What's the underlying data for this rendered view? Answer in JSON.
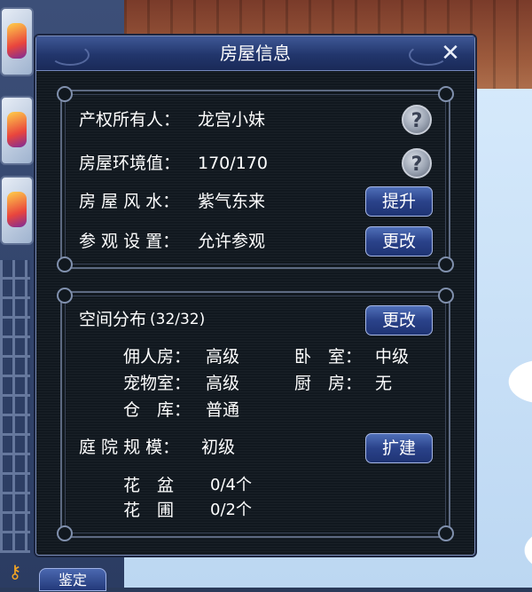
{
  "dialog": {
    "title": "房屋信息",
    "close_icon": "close-icon"
  },
  "house_panel": {
    "owner_label": "产权所有人：",
    "owner_value": "龙宫小妹",
    "env_label": "房屋环境值：",
    "env_value": "170/170",
    "fengshui_label": "房 屋 风 水：",
    "fengshui_value": "紫气东来",
    "fengshui_button": "提升",
    "visit_label": "参 观 设 置：",
    "visit_value": "允许参观",
    "visit_button": "更改",
    "help_icon": "?"
  },
  "space_panel": {
    "title": "空间分布",
    "count": "(32/32)",
    "change_button": "更改",
    "rooms": [
      {
        "label": "佣人房：",
        "value": "高级"
      },
      {
        "label": "卧　室：",
        "value": "中级"
      },
      {
        "label": "宠物室：",
        "value": "高级"
      },
      {
        "label": "厨　房：",
        "value": "无"
      },
      {
        "label": "仓　库：",
        "value": "普通"
      }
    ],
    "yard_label": "庭 院 规 模：",
    "yard_value": "初级",
    "expand_button": "扩建",
    "yard_items": [
      {
        "label": "花　盆",
        "value": "0/4个"
      },
      {
        "label": "花　圃",
        "value": "0/2个"
      }
    ]
  },
  "background": {
    "bottom_button": "鉴定"
  },
  "colors": {
    "dialog_bg": "#11181f",
    "title_bar": "#22366c",
    "button_blue": "#2a428a",
    "text": "#ffffff"
  }
}
